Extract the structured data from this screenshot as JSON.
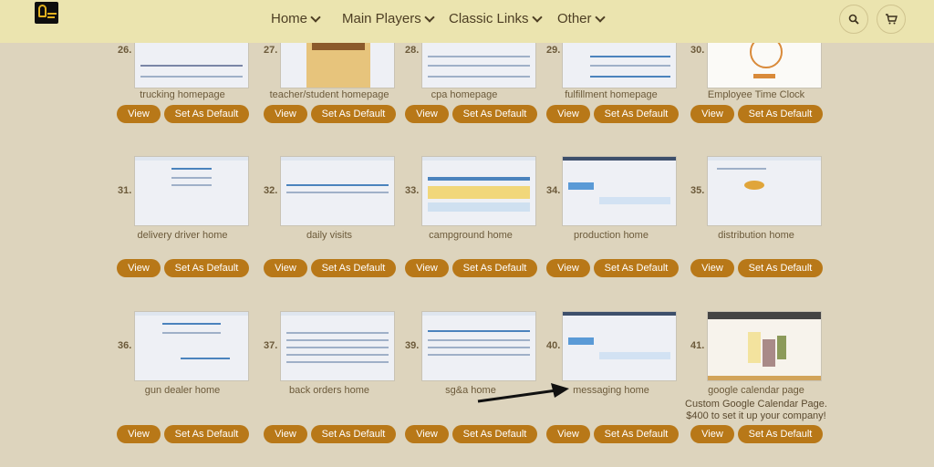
{
  "nav": {
    "items": [
      {
        "label": "Home"
      },
      {
        "label": "Main Players"
      },
      {
        "label": "Classic Links"
      },
      {
        "label": "Other"
      }
    ]
  },
  "colors": {
    "topbar": "#ebe4af",
    "background": "#ddd4bd",
    "button": "#b87818"
  },
  "rows": [
    {
      "tiles": [
        {
          "num": "26.",
          "caption": "trucking homepage"
        },
        {
          "num": "27.",
          "caption": "teacher/student homepage"
        },
        {
          "num": "28.",
          "caption": "cpa homepage"
        },
        {
          "num": "29.",
          "caption": "fulfillment homepage"
        },
        {
          "num": "30.",
          "caption": "Employee Time Clock"
        }
      ]
    },
    {
      "tiles": [
        {
          "num": "31.",
          "caption": "delivery driver home"
        },
        {
          "num": "32.",
          "caption": "daily visits"
        },
        {
          "num": "33.",
          "caption": "campground home"
        },
        {
          "num": "34.",
          "caption": "production home"
        },
        {
          "num": "35.",
          "caption": "distribution home"
        }
      ]
    },
    {
      "tiles": [
        {
          "num": "36.",
          "caption": "gun dealer home"
        },
        {
          "num": "37.",
          "caption": "back orders home"
        },
        {
          "num": "39.",
          "caption": "sg&a home"
        },
        {
          "num": "40.",
          "caption": "messaging home"
        },
        {
          "num": "41.",
          "caption": "google calendar page"
        }
      ]
    }
  ],
  "buttons": {
    "view": "View",
    "set_default": "Set As Default"
  },
  "note": {
    "line1": "Custom Google Calendar Page.",
    "line2": "$400 to set it up your company!"
  }
}
